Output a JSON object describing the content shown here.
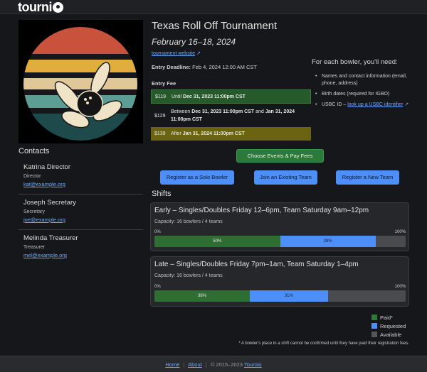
{
  "brand": {
    "name": "tourni"
  },
  "tournament": {
    "title": "Texas Roll Off Tournament",
    "dates": "February 16–18, 2024",
    "website_label": "tournament website",
    "deadline_label": "Entry Deadline:",
    "deadline_value": "Feb 4, 2024 12:00 AM CST",
    "fee_label": "Entry Fee",
    "fees": [
      {
        "amount": "$119",
        "when_prefix": "Until",
        "when": "Dec 31, 2023 11:00pm CST"
      },
      {
        "amount": "$129",
        "when_prefix": "Between",
        "when": "Dec 31, 2023 11:00pm CST",
        "and_label": "and",
        "when2": "Jan 31, 2024 11:00pm CST"
      },
      {
        "amount": "$139",
        "when_prefix": "After",
        "when": "Jan 31, 2024 11:00pm CST"
      }
    ]
  },
  "needs": {
    "heading": "For each bowler, you'll need:",
    "items": [
      "Names and contact information (email, phone, address)",
      "Birth dates (required for IGBO)"
    ],
    "usbc_prefix": "USBC ID –",
    "usbc_link": "look up a USBC identifier"
  },
  "contacts": {
    "title": "Contacts",
    "people": [
      {
        "name": "Katrina Director",
        "role": "Director",
        "email": "kat@example.org"
      },
      {
        "name": "Joseph Secretary",
        "role": "Secretary",
        "email": "joe@example.org"
      },
      {
        "name": "Melinda Treasurer",
        "role": "Treasurer",
        "email": "mel@example.org"
      }
    ]
  },
  "actions": {
    "main": "Choose Events & Pay Fees",
    "solo": "Register as a Solo Bowler",
    "join": "Join an Existing Team",
    "new_team": "Register a New Team"
  },
  "shifts": {
    "title": "Shifts",
    "zero": "0%",
    "hundred": "100%",
    "list": [
      {
        "name": "Early – Singles/Doubles Friday 12–6pm, Team Saturday 9am–12pm",
        "capacity": "Capacity: 16 bowlers / 4 teams",
        "paid": 50,
        "paid_label": "50%",
        "requested": 38,
        "requested_label": "38%"
      },
      {
        "name": "Late – Singles/Doubles Friday 7pm–1am, Team Saturday 1–4pm",
        "capacity": "Capacity: 16 bowlers / 4 teams",
        "paid": 38,
        "paid_label": "38%",
        "requested": 31,
        "requested_label": "31%"
      }
    ],
    "legend": {
      "paid": "Paid*",
      "requested": "Requested",
      "available": "Available"
    },
    "footnote": "* A bowler's place in a shift cannot be confirmed until they have paid their registration fees."
  },
  "footer": {
    "home": "Home",
    "about": "About",
    "copyright": "© 2015–2023",
    "brand_link": "Tournio"
  },
  "colors": {
    "paid": "#2f6e33",
    "requested": "#4d8ef7",
    "available": "#4a4b4f",
    "accent_green": "#2b7a3a"
  }
}
